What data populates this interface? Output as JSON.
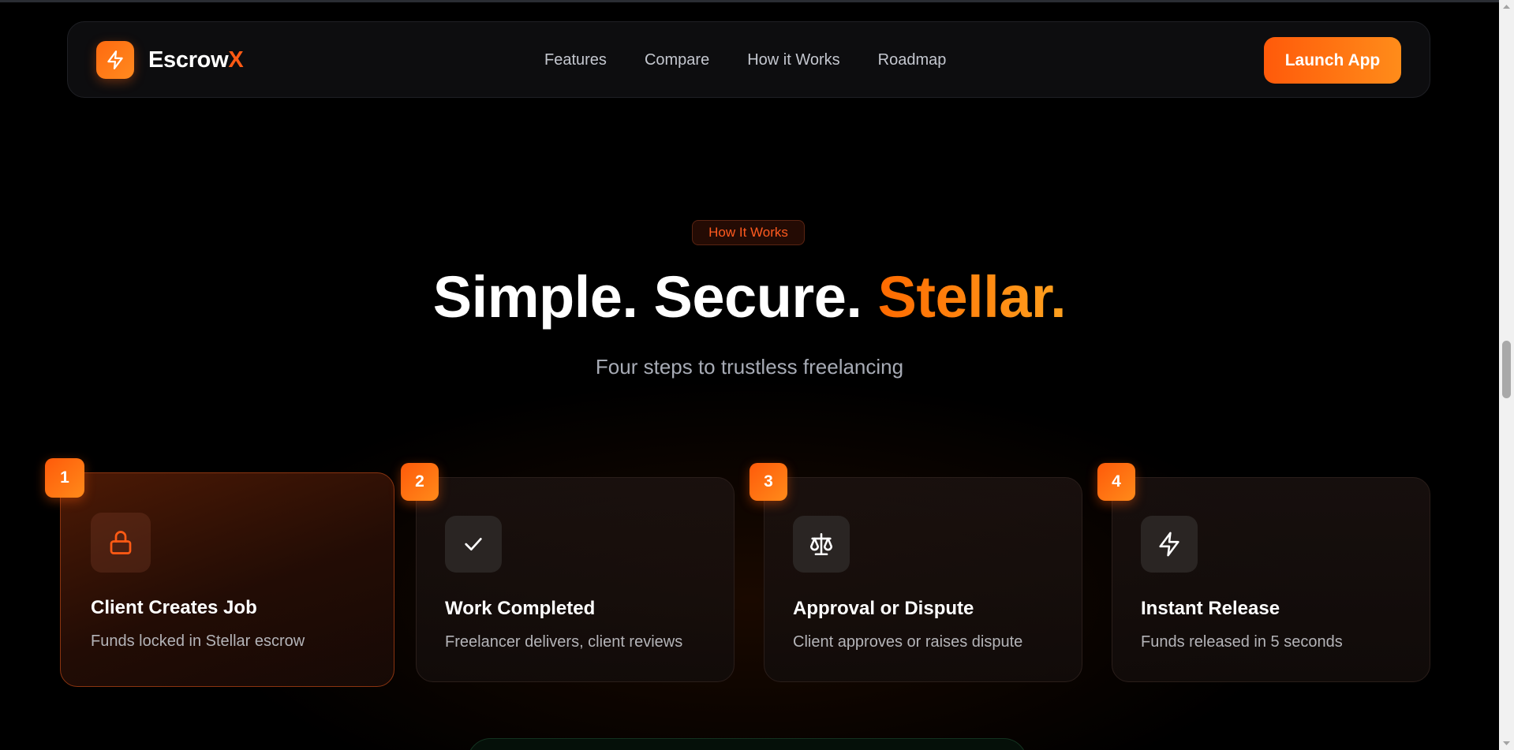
{
  "navbar": {
    "brand_name": "Escrow",
    "brand_accent": "X",
    "links": [
      "Features",
      "Compare",
      "How it Works",
      "Roadmap"
    ],
    "cta_label": "Launch App"
  },
  "hero": {
    "eyebrow": "How It Works",
    "title_main": "Simple. Secure.",
    "title_accent": "Stellar.",
    "subtitle": "Four steps to trustless freelancing"
  },
  "steps": [
    {
      "number": "1",
      "icon": "lock-icon",
      "title": "Client Creates Job",
      "description": "Funds locked in Stellar escrow",
      "active": true
    },
    {
      "number": "2",
      "icon": "check-icon",
      "title": "Work Completed",
      "description": "Freelancer delivers, client reviews",
      "active": false
    },
    {
      "number": "3",
      "icon": "scale-icon",
      "title": "Approval or Dispute",
      "description": "Client approves or raises dispute",
      "active": false
    },
    {
      "number": "4",
      "icon": "lightning-icon",
      "title": "Instant Release",
      "description": "Funds released in 5 seconds",
      "active": false
    }
  ],
  "colors": {
    "accent": "#ff5a14",
    "accent_gradient_end": "#ff8c1a",
    "background": "#000000"
  }
}
